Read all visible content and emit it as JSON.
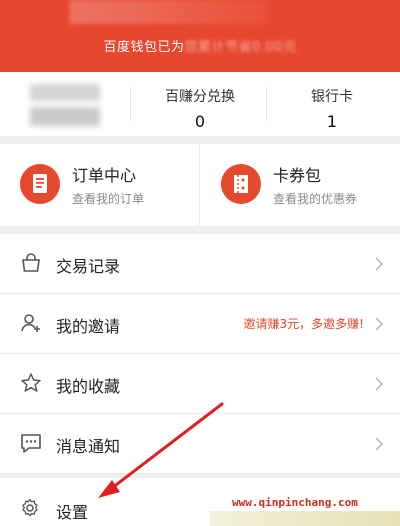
{
  "header": {
    "banner_prefix": "百度钱包已为",
    "banner_blurred": "您累计节省0.00元"
  },
  "account": {
    "stats": [
      {
        "label": "百赚分兑换",
        "value": "0"
      },
      {
        "label": "银行卡",
        "value": "1"
      }
    ]
  },
  "cards": [
    {
      "title": "订单中心",
      "subtitle": "查看我的订单",
      "icon": "order-icon"
    },
    {
      "title": "卡券包",
      "subtitle": "查看我的优惠券",
      "icon": "coupon-icon"
    }
  ],
  "menu": {
    "items": [
      {
        "label": "交易记录",
        "icon": "shopping-bag-icon",
        "extra": ""
      },
      {
        "label": "我的邀请",
        "icon": "invite-user-icon",
        "extra": "邀请赚3元，多邀多赚!"
      },
      {
        "label": "我的收藏",
        "icon": "star-icon",
        "extra": ""
      },
      {
        "label": "消息通知",
        "icon": "message-icon",
        "extra": ""
      }
    ],
    "settings_label": "设置"
  },
  "watermark": "www.qinpinchang.com",
  "colors": {
    "brand_red": "#e8472f",
    "accent_text": "#e2482e",
    "annotation_arrow": "#e02020"
  }
}
